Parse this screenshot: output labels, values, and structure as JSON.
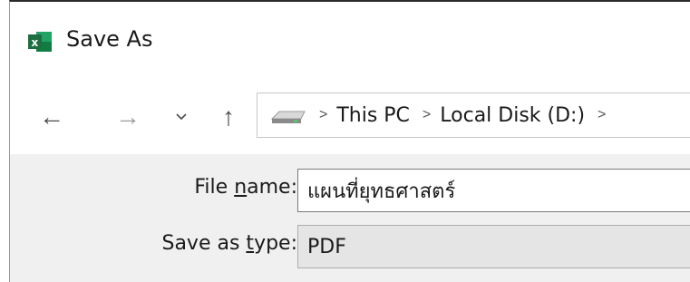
{
  "window": {
    "title": "Save As",
    "app_icon": "excel-icon"
  },
  "navigation": {
    "back": "←",
    "forward": "→",
    "recent": "⌄",
    "up": "↑",
    "breadcrumbs": [
      "This PC",
      "Local Disk (D:)"
    ],
    "separator": ">"
  },
  "form": {
    "file_name_label_pre": "File ",
    "file_name_label_access": "n",
    "file_name_label_post": "ame:",
    "file_name_value": "แผนที่ยุทธศาสตร์",
    "save_type_label_pre": "Save as ",
    "save_type_label_access": "t",
    "save_type_label_post": "ype:",
    "save_type_value": "PDF"
  },
  "colors": {
    "excel_green": "#1d6f42",
    "panel_bg": "#f0f0f0"
  }
}
